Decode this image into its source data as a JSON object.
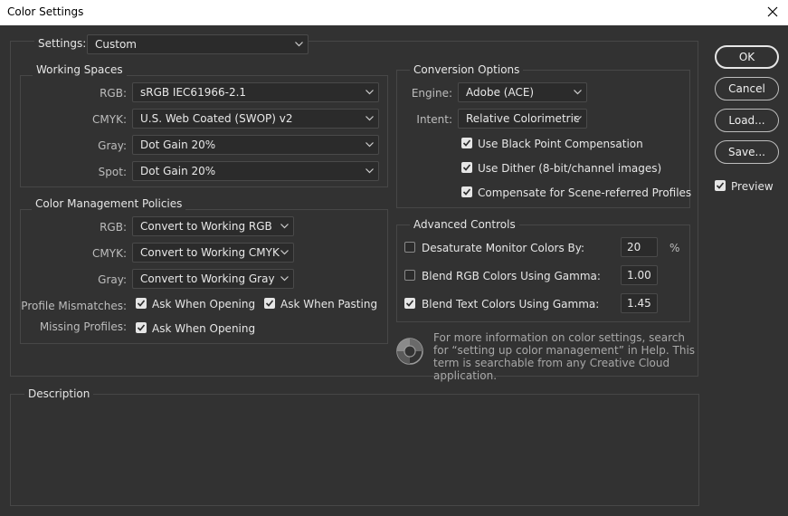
{
  "window": {
    "title": "Color Settings"
  },
  "settings": {
    "label": "Settings:",
    "value": "Custom"
  },
  "working_spaces": {
    "title": "Working Spaces",
    "rgb": {
      "label": "RGB:",
      "value": "sRGB IEC61966-2.1"
    },
    "cmyk": {
      "label": "CMYK:",
      "value": "U.S. Web Coated (SWOP) v2"
    },
    "gray": {
      "label": "Gray:",
      "value": "Dot Gain 20%"
    },
    "spot": {
      "label": "Spot:",
      "value": "Dot Gain 20%"
    }
  },
  "policies": {
    "title": "Color Management Policies",
    "rgb": {
      "label": "RGB:",
      "value": "Convert to Working RGB"
    },
    "cmyk": {
      "label": "CMYK:",
      "value": "Convert to Working CMYK"
    },
    "gray": {
      "label": "Gray:",
      "value": "Convert to Working Gray"
    },
    "mismatches": {
      "label": "Profile Mismatches:",
      "opening": "Ask When Opening",
      "pasting": "Ask When Pasting",
      "opening_checked": true,
      "pasting_checked": true
    },
    "missing": {
      "label": "Missing Profiles:",
      "opening": "Ask When Opening",
      "opening_checked": true
    }
  },
  "conversion": {
    "title": "Conversion Options",
    "engine": {
      "label": "Engine:",
      "value": "Adobe (ACE)"
    },
    "intent": {
      "label": "Intent:",
      "value": "Relative Colorimetric"
    },
    "black_point": {
      "label": "Use Black Point Compensation",
      "checked": true
    },
    "dither": {
      "label": "Use Dither (8-bit/channel images)",
      "checked": true
    },
    "scene": {
      "label": "Compensate for Scene-referred Profiles",
      "checked": true
    }
  },
  "advanced": {
    "title": "Advanced Controls",
    "desaturate": {
      "label": "Desaturate Monitor Colors By:",
      "value": "20",
      "unit": "%",
      "checked": false
    },
    "blend_rgb": {
      "label": "Blend RGB Colors Using Gamma:",
      "value": "1.00",
      "checked": false
    },
    "blend_text": {
      "label": "Blend Text Colors Using Gamma:",
      "value": "1.45",
      "checked": true
    }
  },
  "info": {
    "text": "For more information on color settings, search for “setting up color management” in Help. This term is searchable from any Creative Cloud application."
  },
  "description": {
    "title": "Description"
  },
  "buttons": {
    "ok": "OK",
    "cancel": "Cancel",
    "load": "Load...",
    "save": "Save...",
    "preview": "Preview",
    "preview_checked": true
  },
  "colors": {
    "background": "#323232",
    "titlebar": "#ffffff",
    "field": "#2b2b2b",
    "border": "#474747"
  }
}
